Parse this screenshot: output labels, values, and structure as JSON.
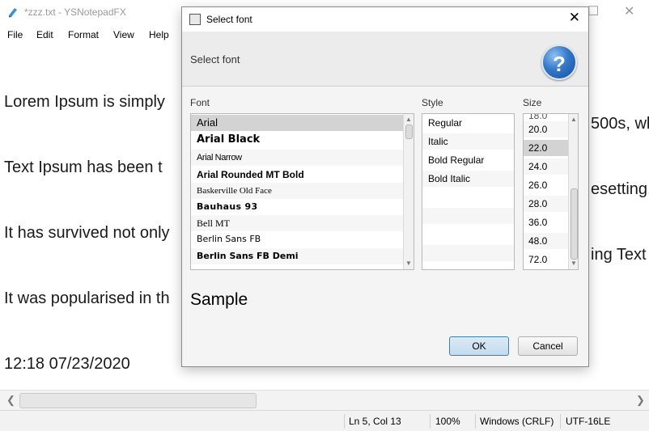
{
  "window": {
    "title": "*zzz.txt - YSNotepadFX",
    "menu": [
      "File",
      "Edit",
      "Format",
      "View",
      "Help"
    ]
  },
  "editor": {
    "lines": [
      "Lorem Ipsum is simply",
      "Text Ipsum has been t",
      "It has survived not only",
      "It was popularised in th",
      "12:18 07/23/2020"
    ],
    "right_fragments": [
      "500s, wh",
      "esetting,",
      "ing Text"
    ]
  },
  "status": {
    "position": "Ln 5, Col 13",
    "zoom": "100%",
    "line_ending": "Windows (CRLF)",
    "encoding": "UTF-16LE"
  },
  "dialog": {
    "title": "Select font",
    "header": "Select font",
    "font_label": "Font",
    "style_label": "Style",
    "size_label": "Size",
    "fonts": [
      "Arial",
      "Arial Black",
      "Arial Narrow",
      "Arial Rounded MT Bold",
      "Baskerville Old Face",
      "Bauhaus 93",
      "Bell MT",
      "Berlin Sans FB",
      "Berlin Sans FB Demi"
    ],
    "selected_font": "Arial",
    "styles": [
      "Regular",
      "Italic",
      "Bold Regular",
      "Bold Italic"
    ],
    "sizes": [
      "20.0",
      "22.0",
      "24.0",
      "26.0",
      "28.0",
      "36.0",
      "48.0",
      "72.0"
    ],
    "selected_size": "22.0",
    "sample": "Sample",
    "ok": "OK",
    "cancel": "Cancel"
  },
  "colors": {
    "selection": "#d3d3d3",
    "ok_border": "#3c7fb1",
    "help_icon": "#3478c9"
  }
}
